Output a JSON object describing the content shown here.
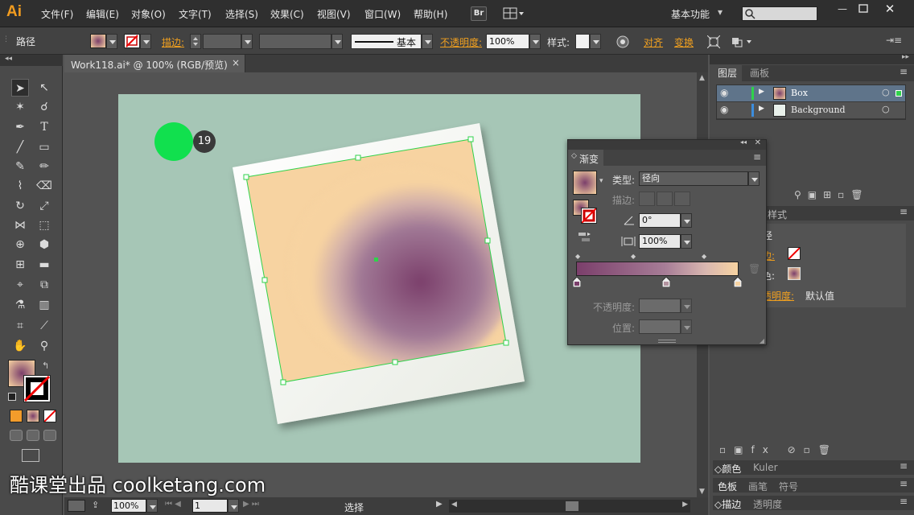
{
  "app": {
    "logo": "Ai"
  },
  "menu": [
    "文件(F)",
    "编辑(E)",
    "对象(O)",
    "文字(T)",
    "选择(S)",
    "效果(C)",
    "视图(V)",
    "窗口(W)",
    "帮助(H)"
  ],
  "toolbar_top": {
    "bridge": "Br",
    "workspace": "基本功能",
    "search_placeholder": ""
  },
  "control_bar": {
    "object_type": "路径",
    "stroke_label": "描边:",
    "stroke_style": "基本",
    "opacity_label": "不透明度:",
    "opacity_value": "100%",
    "style_label": "样式:",
    "align_label": "对齐",
    "transform_label": "变换"
  },
  "document": {
    "tab_title": "Work118.ai* @ 100% (RGB/预览)",
    "close": "×"
  },
  "step_badge": "19",
  "status": {
    "zoom": "100%",
    "page": "1",
    "tool": "选择"
  },
  "layers_panel": {
    "tabs": [
      "图层",
      "画板"
    ],
    "layers": [
      {
        "name": "Box",
        "color": "#2fd24b"
      },
      {
        "name": "Background",
        "color": "#3c8dde"
      }
    ]
  },
  "appearance_panel": {
    "tab": "样式",
    "title_fragment": "径",
    "stroke_fragment": "边:",
    "fill_fragment": "色:",
    "opacity_fragment": "透明度:",
    "opacity_value": "默认值"
  },
  "bottom_tabs": [
    [
      "颜色",
      "Kuler"
    ],
    [
      "色板",
      "画笔",
      "符号"
    ],
    [
      "描边",
      "透明度"
    ]
  ],
  "gradient_panel": {
    "title": "渐变",
    "type_label": "类型:",
    "type_value": "径向",
    "stroke_label": "描边:",
    "angle_value": "0°",
    "ratio_value": "100%",
    "opacity_label": "不透明度:",
    "location_label": "位置:"
  },
  "colors": {
    "accent": "#f0a020",
    "selection": "#2fd24b",
    "gradient_start": "#7b3f6b",
    "gradient_end": "#f7d3a1",
    "artboard_bg": "#a6c6b6"
  },
  "watermark": "酷课堂出品 coolketang.com"
}
